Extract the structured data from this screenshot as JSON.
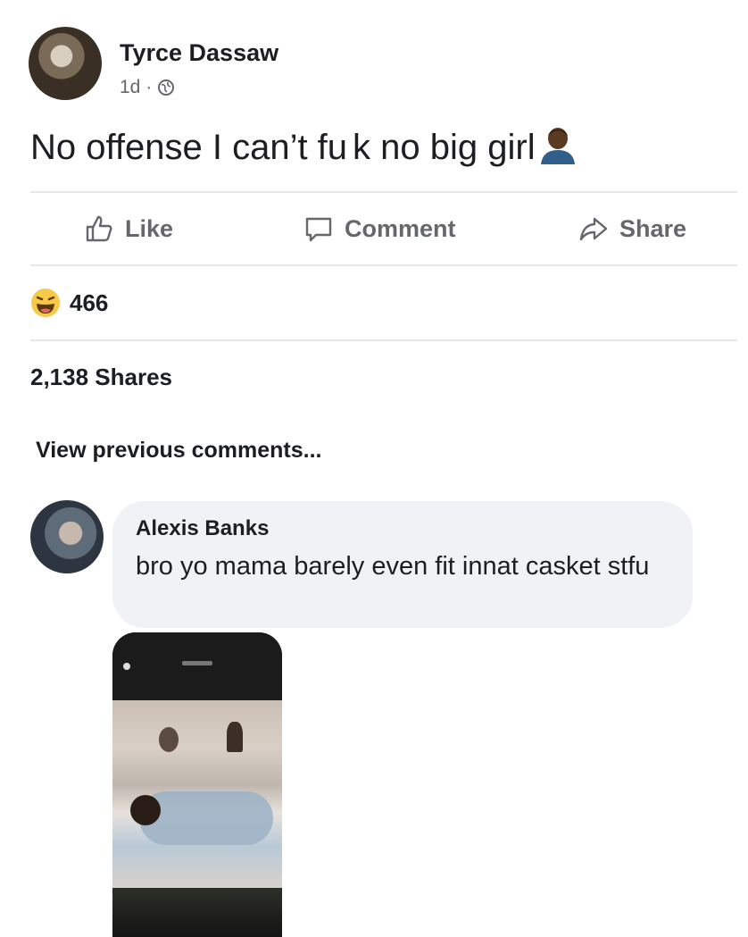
{
  "post": {
    "author": "Tyrce Dassaw",
    "time": "1d ·",
    "privacy_icon": "globe-icon",
    "text": "No offense I can’t fu",
    "text_tail": "k no big girl",
    "emoji": "person-emoji"
  },
  "actions": {
    "like_label": "Like",
    "comment_label": "Comment",
    "share_label": "Share"
  },
  "reactions": {
    "icon": "haha-reaction-icon",
    "count": "466"
  },
  "shares": "2,138 Shares",
  "view_previous": "View previous comments...",
  "comment": {
    "author": "Alexis Banks",
    "text": "bro yo mama barely even fit innat casket stfu"
  },
  "colors": {
    "text_primary": "#1c1e21",
    "text_secondary": "#65676b",
    "bubble": "#f0f2f5",
    "divider": "#e4e6eb",
    "reaction_yellow": "#f7c948"
  }
}
